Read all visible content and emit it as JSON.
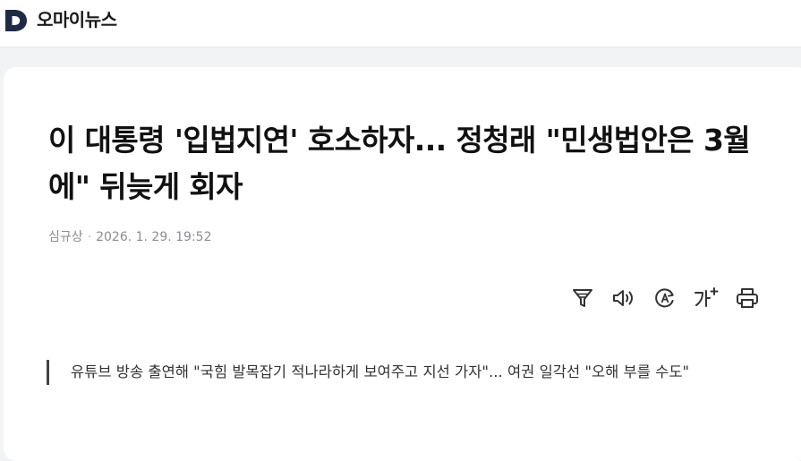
{
  "header": {
    "logo_letter": "D",
    "site_name": "오마이뉴스"
  },
  "article": {
    "headline": "이 대통령 '입법지연' 호소하자... 정청래 \"민생법안은 3월에\" 뒤늦게 회자",
    "author": "심규상",
    "separator": "·",
    "datetime": "2026. 1. 29. 19:52",
    "subheadline": "유튜브 방송 출연해 \"국힘 발목잡기 적나라하게 보여주고 지선 가자\"... 여권 일각선 \"오해 부를 수도\""
  },
  "toolbar": {
    "icons": [
      "filter-icon",
      "speaker-icon",
      "translate-icon",
      "font-size-icon",
      "print-icon"
    ]
  },
  "colors": {
    "logo": "#1f2a44",
    "background": "#f2f3f5",
    "card": "#ffffff",
    "byline": "#8a8d93"
  }
}
